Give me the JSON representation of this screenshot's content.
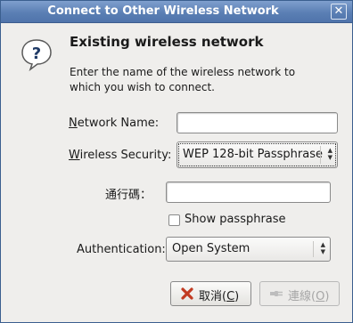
{
  "window": {
    "title": "Connect to Other Wireless Network",
    "close_glyph": "✕"
  },
  "icon": {
    "name": "question-bubble-icon",
    "glyph": "?"
  },
  "heading": "Existing wireless network",
  "description": "Enter the name of the wireless network to which you wish to connect.",
  "form": {
    "network_name": {
      "mnemonic": "N",
      "label_rest": "etwork Name:",
      "value": ""
    },
    "wireless_security": {
      "mnemonic": "W",
      "label_rest": "ireless Security:",
      "value": "WEP 128-bit Passphrase"
    },
    "passphrase": {
      "label": "通行碼：",
      "value": ""
    },
    "show_passphrase": {
      "label": "Show passphrase",
      "checked": false
    },
    "authentication": {
      "label": "Authentication:",
      "value": "Open System"
    }
  },
  "buttons": {
    "cancel": {
      "label": "取消(C)",
      "label_pre": "取消(",
      "mnemonic": "C",
      "label_post": ")",
      "icon": "cancel-x-icon",
      "color": "#c23b22"
    },
    "connect": {
      "label": "連線(O)",
      "label_pre": "連線(",
      "mnemonic": "O",
      "label_post": ")",
      "icon": "connect-plug-icon",
      "enabled": false
    }
  }
}
